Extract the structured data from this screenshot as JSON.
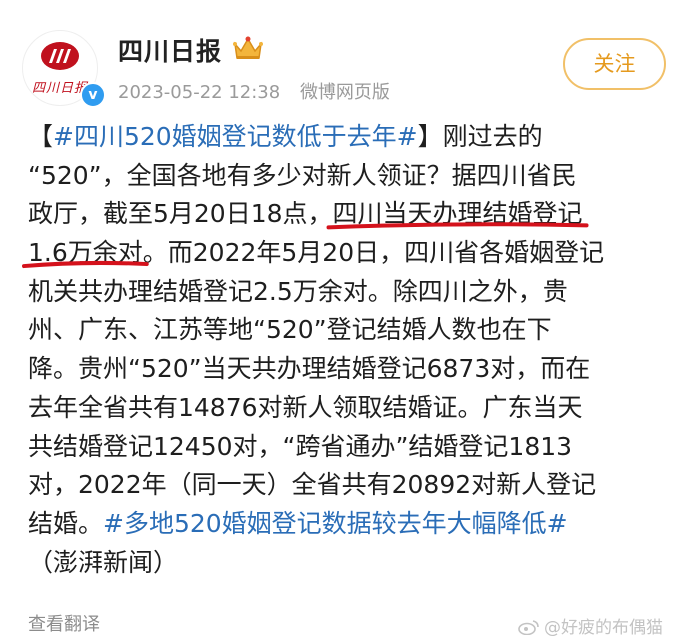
{
  "account": {
    "name": "四川日报",
    "avatar_text": "四川日报",
    "timestamp": "2023-05-22 12:38",
    "source": "微博网页版",
    "follow_label": "关注"
  },
  "post": {
    "lines": [
      [
        {
          "t": "【",
          "c": ""
        },
        {
          "t": "#四川520婚姻登记数低于去年#",
          "c": "hashtag"
        },
        {
          "t": "】刚过去的",
          "c": ""
        }
      ],
      [
        {
          "t": "“520”，全国各地有多少对新人领证？据四川省民",
          "c": ""
        }
      ],
      [
        {
          "t": "政厅，截至5月20日18点，",
          "c": ""
        },
        {
          "t": "四川当天办理结婚登记",
          "c": "hl"
        }
      ],
      [
        {
          "t": "1.6万余对",
          "c": "hl"
        },
        {
          "t": "。而2022年5月20日，四川省各婚姻登记",
          "c": ""
        }
      ],
      [
        {
          "t": "机关共办理结婚登记2.5万余对。除四川之外，贵",
          "c": ""
        }
      ],
      [
        {
          "t": "州、广东、江苏等地“520”登记结婚人数也在下",
          "c": ""
        }
      ],
      [
        {
          "t": "降。贵州“520”当天共办理结婚登记6873对，而在",
          "c": ""
        }
      ],
      [
        {
          "t": "去年全省共有14876对新人领取结婚证。广东当天",
          "c": ""
        }
      ],
      [
        {
          "t": "共结婚登记12450对，“跨省通办”结婚登记1813",
          "c": ""
        }
      ],
      [
        {
          "t": "对，2022年（同一天）全省共有20892对新人登记",
          "c": ""
        }
      ],
      [
        {
          "t": "结婚。",
          "c": ""
        },
        {
          "t": "#多地520婚姻登记数据较去年大幅降低#",
          "c": "hashtag"
        }
      ],
      [
        {
          "t": "（澎湃新闻）",
          "c": ""
        }
      ]
    ]
  },
  "footer": {
    "translate_label": "查看翻译",
    "watermark": "@好疲的布偶猫"
  },
  "colors": {
    "hashtag": "#2a6db7",
    "underline": "#d4121c",
    "follow": "#e59a1e",
    "meta": "#9a9a9a"
  },
  "icons": [
    "newspaper-logo-icon",
    "verified-icon",
    "crown-badge-icon",
    "weibo-watermark-icon"
  ]
}
